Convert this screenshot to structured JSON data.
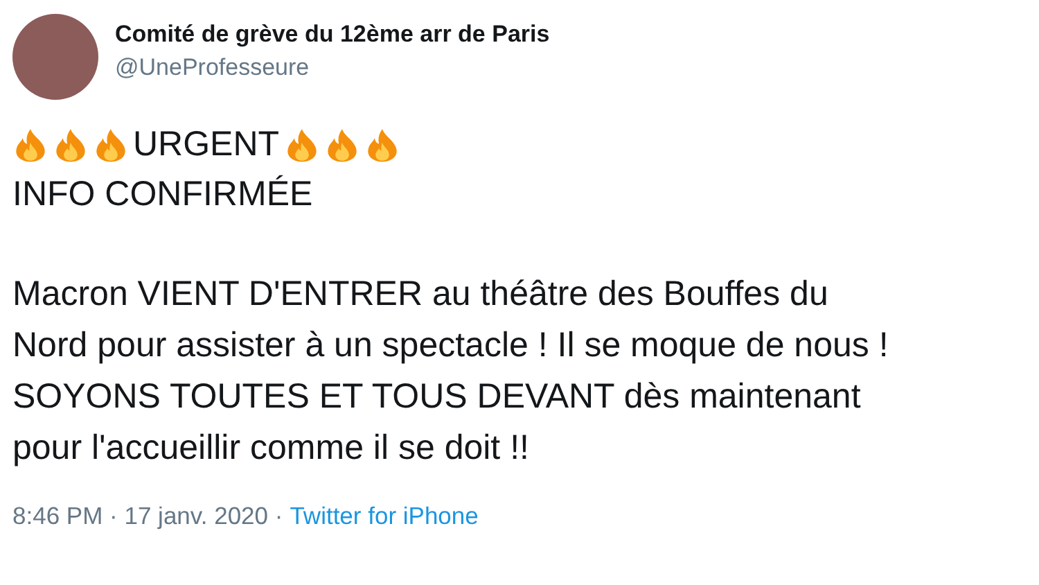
{
  "author": {
    "name": "Comité de grève du 12ème arr de Paris",
    "handle": "@UneProfesseure"
  },
  "headline": [
    {
      "kind": "fire"
    },
    {
      "kind": "fire"
    },
    {
      "kind": "fire"
    },
    {
      "kind": "text",
      "text": "URGENT"
    },
    {
      "kind": "fire"
    },
    {
      "kind": "fire"
    },
    {
      "kind": "fire"
    }
  ],
  "subheadline": "INFO CONFIRMÉE",
  "body": "Macron VIENT D'ENTRER au théâtre des Bouffes du\nNord pour assister à un spectacle ! Il se moque de nous !\nSOYONS TOUTES ET TOUS DEVANT dès maintenant\npour l'accueillir comme il se doit !!",
  "footer": {
    "timestamp": "8:46 PM · 17 janv. 2020 ·",
    "source": "Twitter for iPhone"
  }
}
